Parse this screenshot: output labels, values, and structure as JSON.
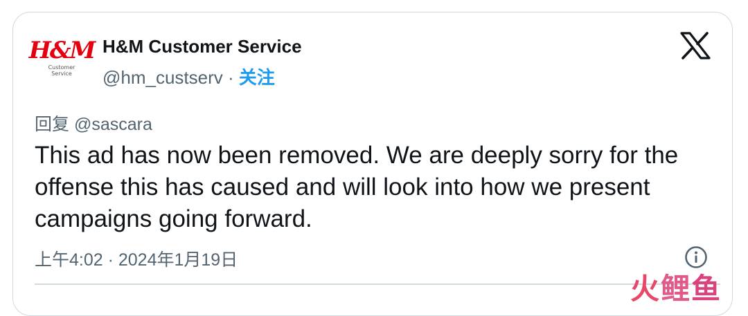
{
  "tweet": {
    "avatar": {
      "logo_text": "H&M",
      "sub_line1": "Customer",
      "sub_line2": "Service"
    },
    "author_name": "H&M Customer Service",
    "handle": "@hm_custserv",
    "separator": " · ",
    "follow_label": "关注",
    "reply_to": "回复 @sascara",
    "text": "This ad has now been removed. We are deeply sorry for the offense this has caused and will look into how we present campaigns going forward.",
    "timestamp": "上午4:02 · 2024年1月19日"
  },
  "watermark": {
    "c1": "火",
    "c2": "鲤",
    "c3": "鱼"
  },
  "icons": {
    "platform": "x-logo-icon",
    "info": "info-icon"
  },
  "colors": {
    "text": "#0f1419",
    "secondary": "#536471",
    "accent": "#1d9bf0",
    "brand": "#e50010"
  }
}
